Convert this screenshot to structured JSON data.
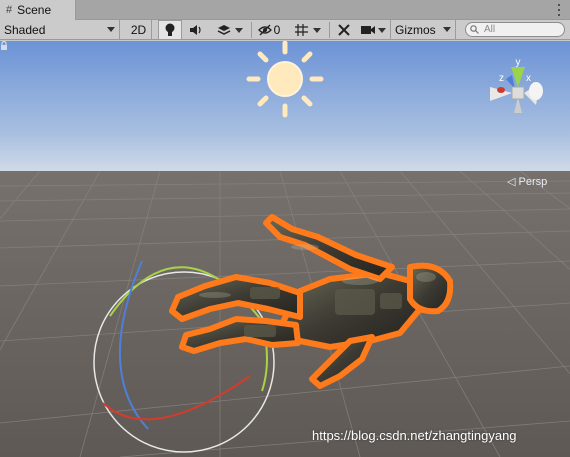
{
  "tab": {
    "icon": "grid-icon",
    "label": "Scene"
  },
  "toolbar": {
    "shading_mode": "Shaded",
    "mode_2d_label": "2D",
    "hidden_count": "0",
    "gizmos_label": "Gizmos",
    "search_placeholder": "All"
  },
  "scene_gizmo": {
    "projection_label": "Persp",
    "axis_labels": {
      "y": "y",
      "x": "x",
      "z": "z"
    }
  },
  "watermark": "https://blog.csdn.net/zhangtingyang",
  "colors": {
    "sky_top": "#6d94d6",
    "horizon": "#c9d6e8",
    "ground": "#5f5a55",
    "selection_outline": "#ff7a1a",
    "sun": "#ffe9bd"
  }
}
